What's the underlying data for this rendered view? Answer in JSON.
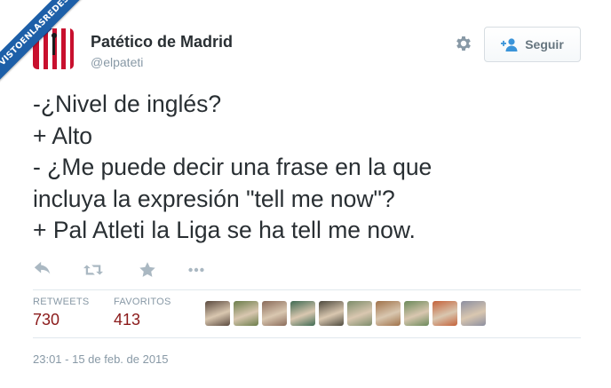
{
  "watermark": {
    "text": "VISTOENLASREDES"
  },
  "author": {
    "name": "Patético de Madrid",
    "handle": "@elpateti",
    "avatar_icon": "atletico-crest-avatar"
  },
  "follow_button": {
    "label": "Seguir",
    "icon": "add-user-icon"
  },
  "settings_icon": "gear-icon",
  "tweet": {
    "lines": [
      "-¿Nivel de inglés?",
      "+ Alto",
      "- ¿Me puede decir una frase en la que",
      "incluya la expresión \"tell me now\"?",
      "+ Pal Atleti la Liga se ha tell me now."
    ]
  },
  "actions": [
    {
      "name": "reply",
      "icon": "reply-icon"
    },
    {
      "name": "retweet",
      "icon": "retweet-icon"
    },
    {
      "name": "favorite",
      "icon": "star-icon"
    },
    {
      "name": "more",
      "icon": "more-dots-icon"
    }
  ],
  "stats": {
    "retweets_label": "RETWEETS",
    "retweets_value": "730",
    "favorites_label": "FAVORITOS",
    "favorites_value": "413"
  },
  "favoriters": [
    {
      "color": "#5b4a3f"
    },
    {
      "color": "#6b7d4a"
    },
    {
      "color": "#8a6b5a"
    },
    {
      "color": "#3f6a52"
    },
    {
      "color": "#4e4a3e"
    },
    {
      "color": "#7c8c6a"
    },
    {
      "color": "#a0724a"
    },
    {
      "color": "#6b8a5a"
    },
    {
      "color": "#c4623a"
    },
    {
      "color": "#8c8fa0"
    }
  ],
  "timestamp": "23:01 - 15 de feb. de 2015",
  "colors": {
    "stat_value": "#8b1a1a",
    "meta_text": "#8899a6",
    "watermark": "#1d5fa8"
  }
}
